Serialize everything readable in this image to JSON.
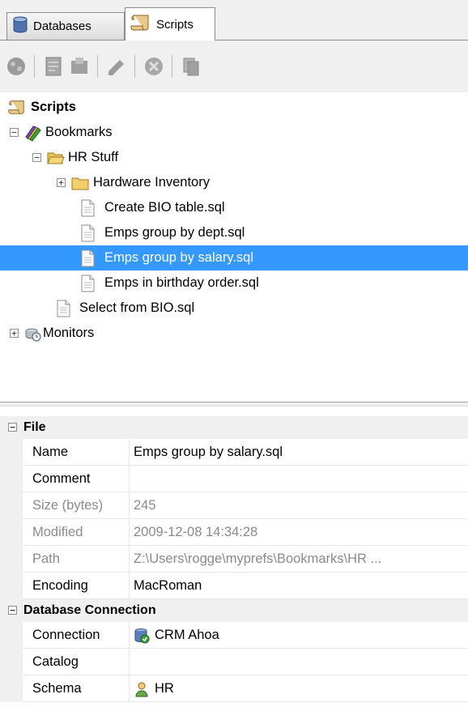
{
  "tabs": [
    {
      "label": "Databases",
      "icon": "database-icon",
      "active": false
    },
    {
      "label": "Scripts",
      "icon": "scroll-icon",
      "active": true
    }
  ],
  "toolbar": {
    "buttons": [
      {
        "icon": "connect-icon",
        "enabled": false
      },
      {
        "icon": "new-script-icon",
        "enabled": false
      },
      {
        "icon": "export-icon",
        "enabled": false
      },
      {
        "icon": "edit-icon",
        "enabled": false
      },
      {
        "icon": "delete-icon",
        "enabled": false
      },
      {
        "icon": "copy-icon",
        "enabled": false
      }
    ]
  },
  "tree": {
    "root": {
      "label": "Scripts"
    },
    "bookmarks": {
      "label": "Bookmarks",
      "expanded": true
    },
    "hr_stuff": {
      "label": "HR Stuff",
      "expanded": true
    },
    "hardware_inventory": {
      "label": "Hardware Inventory",
      "expanded": false
    },
    "files": [
      {
        "label": "Create BIO table.sql"
      },
      {
        "label": "Emps group by dept.sql"
      },
      {
        "label": "Emps group by salary.sql",
        "selected": true
      },
      {
        "label": "Emps in birthday order.sql"
      }
    ],
    "select_bio": {
      "label": "Select from BIO.sql"
    },
    "monitors": {
      "label": "Monitors",
      "expanded": false
    }
  },
  "properties": {
    "file": {
      "title": "File",
      "rows": [
        {
          "name": "Name",
          "value": "Emps group by salary.sql",
          "readonly": false
        },
        {
          "name": "Comment",
          "value": "",
          "readonly": false
        },
        {
          "name": "Size (bytes)",
          "value": "245",
          "readonly": true
        },
        {
          "name": "Modified",
          "value": "2009-12-08 14:34:28",
          "readonly": true
        },
        {
          "name": "Path",
          "value": "Z:\\Users\\rogge\\myprefs\\Bookmarks\\HR ...",
          "readonly": true
        },
        {
          "name": "Encoding",
          "value": "MacRoman",
          "readonly": false
        }
      ]
    },
    "db": {
      "title": "Database Connection",
      "rows": [
        {
          "name": "Connection",
          "value": "CRM Ahoa",
          "icon": "database-connection-icon"
        },
        {
          "name": "Catalog",
          "value": ""
        },
        {
          "name": "Schema",
          "value": "HR",
          "icon": "schema-user-icon"
        }
      ]
    }
  },
  "colors": {
    "selection": "#3399ff",
    "chrome": "#f0f0f0",
    "readonly_text": "#8a8a8a"
  }
}
